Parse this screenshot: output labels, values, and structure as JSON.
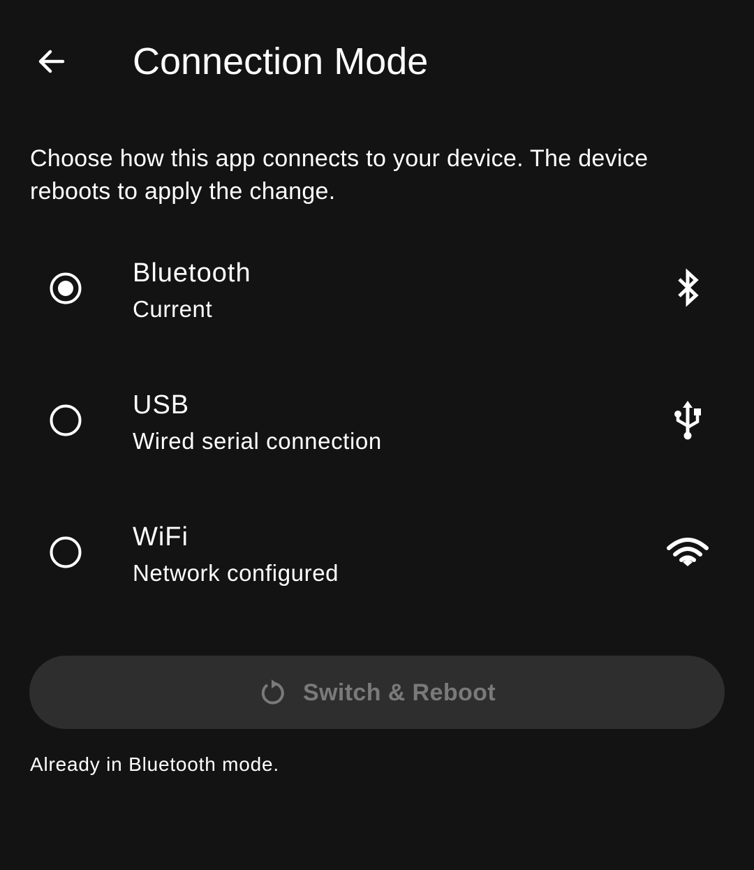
{
  "header": {
    "title": "Connection Mode",
    "back_icon": "arrow-back-icon"
  },
  "description": "Choose how this app connects to your device. The device reboots to apply the change.",
  "options": [
    {
      "title": "Bluetooth",
      "subtitle": "Current",
      "selected": true,
      "icon": "bluetooth-icon"
    },
    {
      "title": "USB",
      "subtitle": "Wired serial connection",
      "selected": false,
      "icon": "usb-icon"
    },
    {
      "title": "WiFi",
      "subtitle": "Network configured",
      "selected": false,
      "icon": "wifi-icon"
    }
  ],
  "action_button": {
    "label": "Switch & Reboot",
    "icon": "restart-icon",
    "enabled": false
  },
  "status": "Already in Bluetooth mode.",
  "colors": {
    "background": "#131313",
    "text": "#ffffff",
    "button_background": "#2e2e2e",
    "button_disabled_text": "#7a7a7a"
  }
}
